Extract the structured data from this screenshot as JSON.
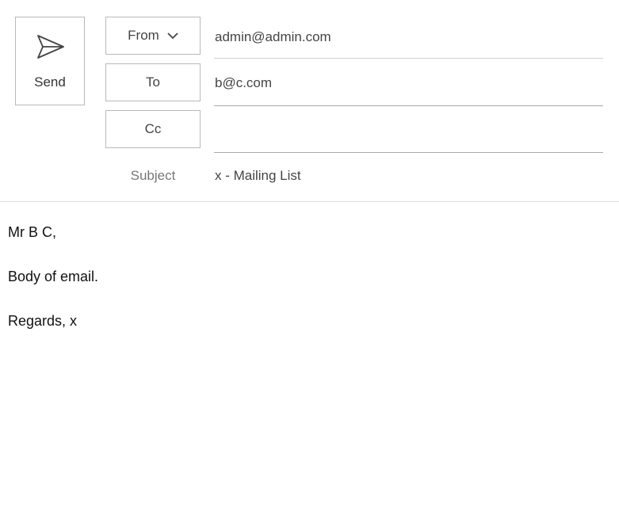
{
  "send": {
    "label": "Send",
    "icon": "send-icon"
  },
  "fields": {
    "from_label": "From",
    "from_value": "admin@admin.com",
    "to_label": "To",
    "to_value": "b@c.com",
    "cc_label": "Cc",
    "cc_value": "",
    "subject_label": "Subject",
    "subject_value": "x - Mailing List"
  },
  "body": {
    "greeting": "Mr B C,",
    "content": "Body of email.",
    "signoff": "Regards, x"
  },
  "colors": {
    "border": "#b9b9b9",
    "text": "#444444",
    "divider": "#dedede"
  }
}
